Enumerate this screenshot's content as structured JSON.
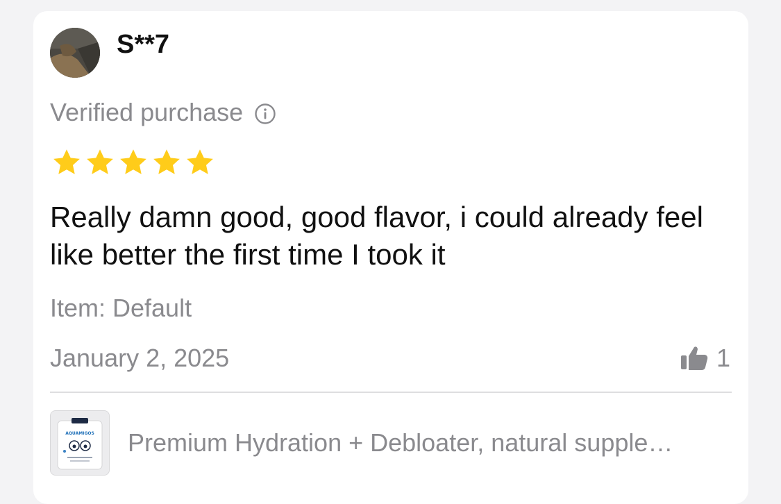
{
  "review": {
    "username": "S**7",
    "verified_label": "Verified purchase",
    "rating": 5,
    "rating_max": 5,
    "text": "Really damn good, good flavor, i could already feel like better the first time I took it",
    "item_label": "Item: Default",
    "date": "January 2, 2025",
    "helpful_count": "1"
  },
  "product": {
    "title": "Premium Hydration + Debloater, natural supple…",
    "brand_text": "AQUAMIGOS"
  },
  "colors": {
    "star": "#FFCC1A",
    "muted_text": "#8a8a8e",
    "primary_text": "#111111",
    "card_bg": "#ffffff",
    "page_bg": "#f3f3f5"
  },
  "icons": {
    "info": "info-circle-icon",
    "star": "star-icon",
    "thumbs_up": "thumbs-up-icon"
  }
}
